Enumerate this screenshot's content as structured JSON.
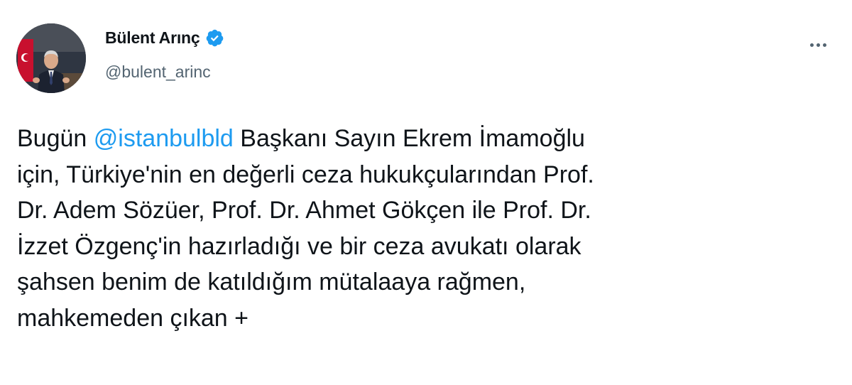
{
  "author": {
    "display_name": "Bülent Arınç",
    "handle": "@bulent_arinc",
    "verified": true,
    "verified_icon": "verified-badge-icon",
    "avatar": "profile-photo"
  },
  "more_icon": "more-horizontal-icon",
  "tweet": {
    "lines": [
      {
        "before": "Bugün ",
        "mention": "@istanbulbld",
        "after": " Başkanı Sayın Ekrem İmamoğlu"
      },
      {
        "text": "için, Türkiye'nin en değerli ceza hukukçularından Prof."
      },
      {
        "text": "Dr. Adem Sözüer, Prof. Dr. Ahmet Gökçen ile Prof. Dr."
      },
      {
        "text": "İzzet Özgenç'in hazırladığı ve bir ceza avukatı olarak"
      },
      {
        "text": "şahsen benim de katıldığım mütalaaya rağmen,"
      },
      {
        "text": "mahkemeden çıkan +"
      }
    ]
  },
  "colors": {
    "text": "#0f1419",
    "secondary": "#536471",
    "link": "#1d9bf0",
    "verified": "#1d9bf0"
  }
}
